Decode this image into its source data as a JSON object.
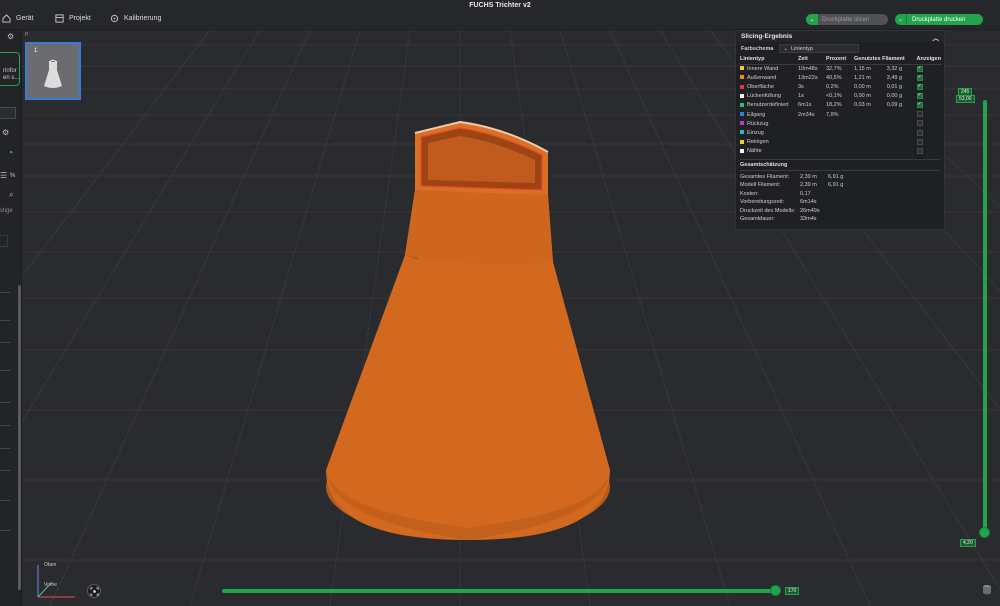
{
  "window": {
    "title": "FUCHS Trichter v2"
  },
  "menu": {
    "device": "Gerät",
    "project": "Projekt",
    "calibration": "Kalibrierung"
  },
  "actions": {
    "slice_label": "Druckplatte slicen",
    "print_label": "Druckplatte drucken"
  },
  "sidebar": {
    "text_1": "rinfor",
    "text_2": "en s...",
    "text_3": "%",
    "text_4": "stige"
  },
  "plate": {
    "number": "1",
    "label": "P"
  },
  "slicing": {
    "title": "Slicing-Ergebnis",
    "scheme_label": "Farbschema",
    "scheme_value": "Linientyp",
    "headers": [
      "Linientyp",
      "Zeit",
      "Prozent",
      "Genutztes Filament",
      "Anzeigen"
    ],
    "rows": [
      {
        "name": "Innere Wand",
        "time": "10m48s",
        "pct": "32,7%",
        "len": "1,15 m",
        "weight": "3,32 g",
        "color": "#f5c542",
        "shown": true
      },
      {
        "name": "Außenwand",
        "time": "13m22s",
        "pct": "40,5%",
        "len": "1,21 m",
        "weight": "3,49 g",
        "color": "#f08a24",
        "shown": true
      },
      {
        "name": "Oberfläche",
        "time": "3s",
        "pct": "0,2%",
        "len": "0,00 m",
        "weight": "0,01 g",
        "color": "#e03b3b",
        "shown": true
      },
      {
        "name": "Lückenfüllung",
        "time": "1s",
        "pct": "<0,1%",
        "len": "0,00 m",
        "weight": "0,00 g",
        "color": "#f2f2f2",
        "shown": true
      },
      {
        "name": "Benutzerdefiniert",
        "time": "6m1s",
        "pct": "18,2%",
        "len": "0,03 m",
        "weight": "0,09 g",
        "color": "#2fbf71",
        "shown": true
      },
      {
        "name": "Eilgang",
        "time": "2m34s",
        "pct": "7,8%",
        "len": "",
        "weight": "",
        "color": "#3a7bd5",
        "shown": false
      },
      {
        "name": "Rückzug",
        "time": "",
        "pct": "",
        "len": "",
        "weight": "",
        "color": "#c436c4",
        "shown": false
      },
      {
        "name": "Einzug",
        "time": "",
        "pct": "",
        "len": "",
        "weight": "",
        "color": "#2ab7c9",
        "shown": false
      },
      {
        "name": "Reinigen",
        "time": "",
        "pct": "",
        "len": "",
        "weight": "",
        "color": "#e8d22a",
        "shown": false
      },
      {
        "name": "Nähte",
        "time": "",
        "pct": "",
        "len": "",
        "weight": "",
        "color": "#f2f2f2",
        "shown": false
      }
    ],
    "summary_title": "Gesamtschätzung",
    "summary": [
      {
        "k": "Gesamtes Filament:",
        "v1": "2,39 m",
        "v2": "6,91 g"
      },
      {
        "k": "Modell Filament:",
        "v1": "2,39 m",
        "v2": "6,91 g"
      },
      {
        "k": "Kosten:",
        "v1": "0,17",
        "v2": ""
      },
      {
        "k": "Vorbereitungszeit:",
        "v1": "6m14s",
        "v2": ""
      },
      {
        "k": "Druckzeit des Modells:",
        "v1": "26m49s",
        "v2": ""
      },
      {
        "k": "Gesamtdauer:",
        "v1": "33m4s",
        "v2": ""
      }
    ]
  },
  "sliders": {
    "layer_top_a": "245",
    "layer_top_b": "53,00",
    "layer_bottom": "4,20",
    "move_value": "170"
  },
  "axes": {
    "top": "Oben",
    "front": "Vorne"
  },
  "colors": {
    "accent": "#22a34c",
    "model": "#d2691f",
    "panel": "#1f2023"
  }
}
